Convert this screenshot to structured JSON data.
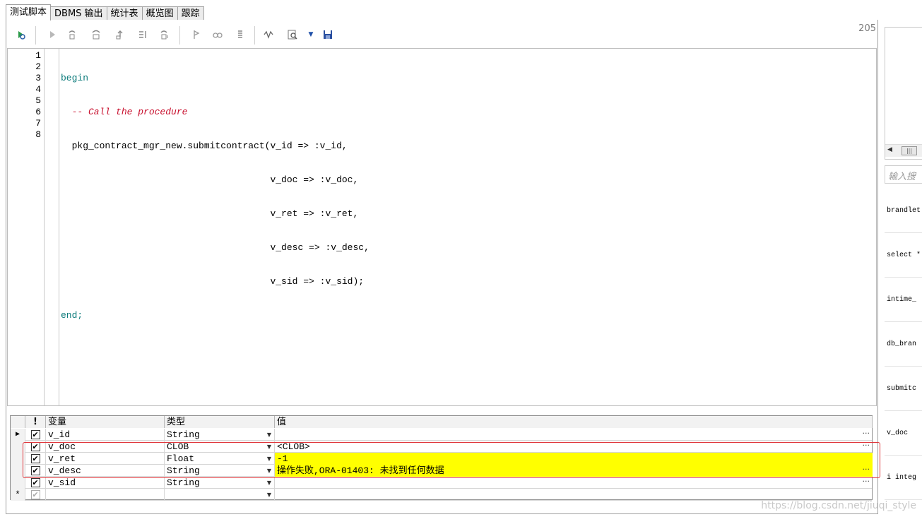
{
  "tabs": [
    {
      "label": "测试脚本",
      "active": true
    },
    {
      "label": "DBMS 输出",
      "active": false
    },
    {
      "label": "统计表",
      "active": false
    },
    {
      "label": "概览图",
      "active": false
    },
    {
      "label": "跟踪",
      "active": false
    }
  ],
  "toolbar": {
    "counter": "205",
    "icons": [
      "run-icon",
      "play-icon",
      "step-into-icon",
      "step-over-icon",
      "step-out-icon",
      "run-to-cursor-icon",
      "run-to-exception-icon",
      "breakpoint-icon",
      "watch-icon",
      "stack-icon",
      "debug-trace-icon",
      "find-icon",
      "dropdown-arrow-icon",
      "save-icon"
    ]
  },
  "editor": {
    "line_numbers": [
      "1",
      "2",
      "3",
      "4",
      "5",
      "6",
      "7",
      "8"
    ],
    "lines": {
      "l1": "begin",
      "l2": "  -- Call the procedure",
      "l3": "  pkg_contract_mgr_new.submitcontract(v_id => :v_id,",
      "l4": "                                      v_doc => :v_doc,",
      "l5": "                                      v_ret => :v_ret,",
      "l6": "                                      v_desc => :v_desc,",
      "l7": "                                      v_sid => :v_sid);",
      "l8": "end;"
    }
  },
  "grid": {
    "headers": {
      "flag": "!",
      "variable": "变量",
      "type": "类型",
      "value": "值"
    },
    "rows": [
      {
        "name": "v_id",
        "type": "String",
        "value": "",
        "highlight": false
      },
      {
        "name": "v_doc",
        "type": "CLOB",
        "value": "<CLOB>",
        "highlight": false
      },
      {
        "name": "v_ret",
        "type": "Float",
        "value": "-1",
        "highlight": true
      },
      {
        "name": "v_desc",
        "type": "String",
        "value": "操作失败,ORA-01403: 未找到任何数据",
        "highlight": true
      },
      {
        "name": "v_sid",
        "type": "String",
        "value": "",
        "highlight": false
      }
    ],
    "new_row_marker": "*"
  },
  "right_panel": {
    "search_placeholder": "输入搜",
    "items": [
      "brandlet",
      "select *",
      "intime_",
      "db_bran",
      "submitc",
      "v_doc",
      "i integ"
    ]
  },
  "watermark": "https://blog.csdn.net/jiuqi_style"
}
